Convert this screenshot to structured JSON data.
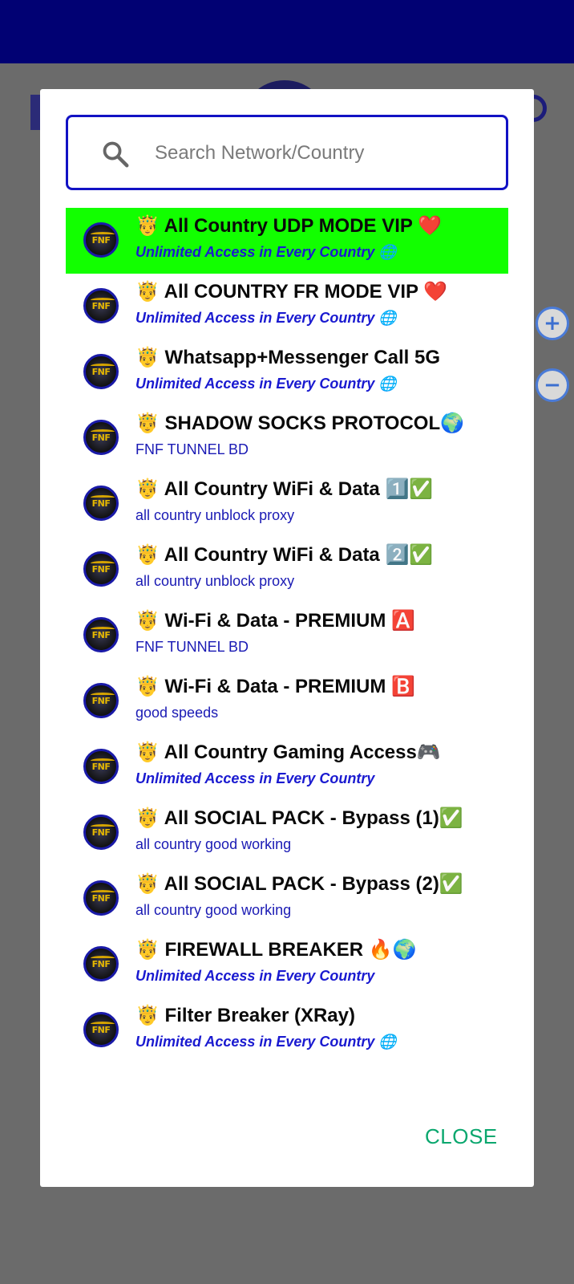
{
  "search": {
    "placeholder": "Search Network/Country",
    "icon": "search-icon"
  },
  "servers": [
    {
      "title": "🤴 All Country UDP MODE VIP ❤️",
      "subtitle": "Unlimited Access in Every Country 🌐",
      "italic": true,
      "selected": true
    },
    {
      "title": "🤴 All COUNTRY FR MODE VIP ❤️",
      "subtitle": "Unlimited Access in Every Country 🌐",
      "italic": true,
      "selected": false
    },
    {
      "title": "🤴 Whatsapp+Messenger Call 5G",
      "subtitle": "Unlimited Access in Every Country 🌐",
      "italic": true,
      "selected": false
    },
    {
      "title": "🤴 SHADOW SOCKS PROTOCOL🌍",
      "subtitle": "FNF TUNNEL BD",
      "italic": false,
      "selected": false
    },
    {
      "title": "🤴 All Country WiFi & Data 1️⃣✅",
      "subtitle": "all country unblock proxy",
      "italic": false,
      "selected": false
    },
    {
      "title": "🤴 All Country WiFi & Data 2️⃣✅",
      "subtitle": "all country unblock proxy",
      "italic": false,
      "selected": false
    },
    {
      "title": "🤴 Wi-Fi & Data - PREMIUM 🅰️",
      "subtitle": "FNF TUNNEL BD",
      "italic": false,
      "selected": false
    },
    {
      "title": "🤴 Wi-Fi & Data - PREMIUM 🅱️",
      "subtitle": "good speeds",
      "italic": false,
      "selected": false
    },
    {
      "title": "🤴 All Country Gaming Access🎮",
      "subtitle": "Unlimited Access in Every Country",
      "italic": true,
      "selected": false
    },
    {
      "title": "🤴 All SOCIAL PACK - Bypass (1)✅",
      "subtitle": "all country good working",
      "italic": false,
      "selected": false
    },
    {
      "title": "🤴 All SOCIAL PACK - Bypass (2)✅",
      "subtitle": "all country good working",
      "italic": false,
      "selected": false
    },
    {
      "title": "🤴 FIREWALL BREAKER 🔥🌍",
      "subtitle": "Unlimited Access in Every Country",
      "italic": true,
      "selected": false
    },
    {
      "title": "🤴 Filter Breaker (XRay)",
      "subtitle": "Unlimited Access in Every Country 🌐",
      "italic": true,
      "selected": false
    }
  ],
  "avatar_text": "FNF",
  "dialog": {
    "close_label": "CLOSE"
  },
  "side": {
    "zoom_in": "+",
    "zoom_out": "−"
  },
  "colors": {
    "topbar": "#010173",
    "selected_row": "#12ff00",
    "accent": "#1212c4",
    "close": "#0aa76e"
  }
}
